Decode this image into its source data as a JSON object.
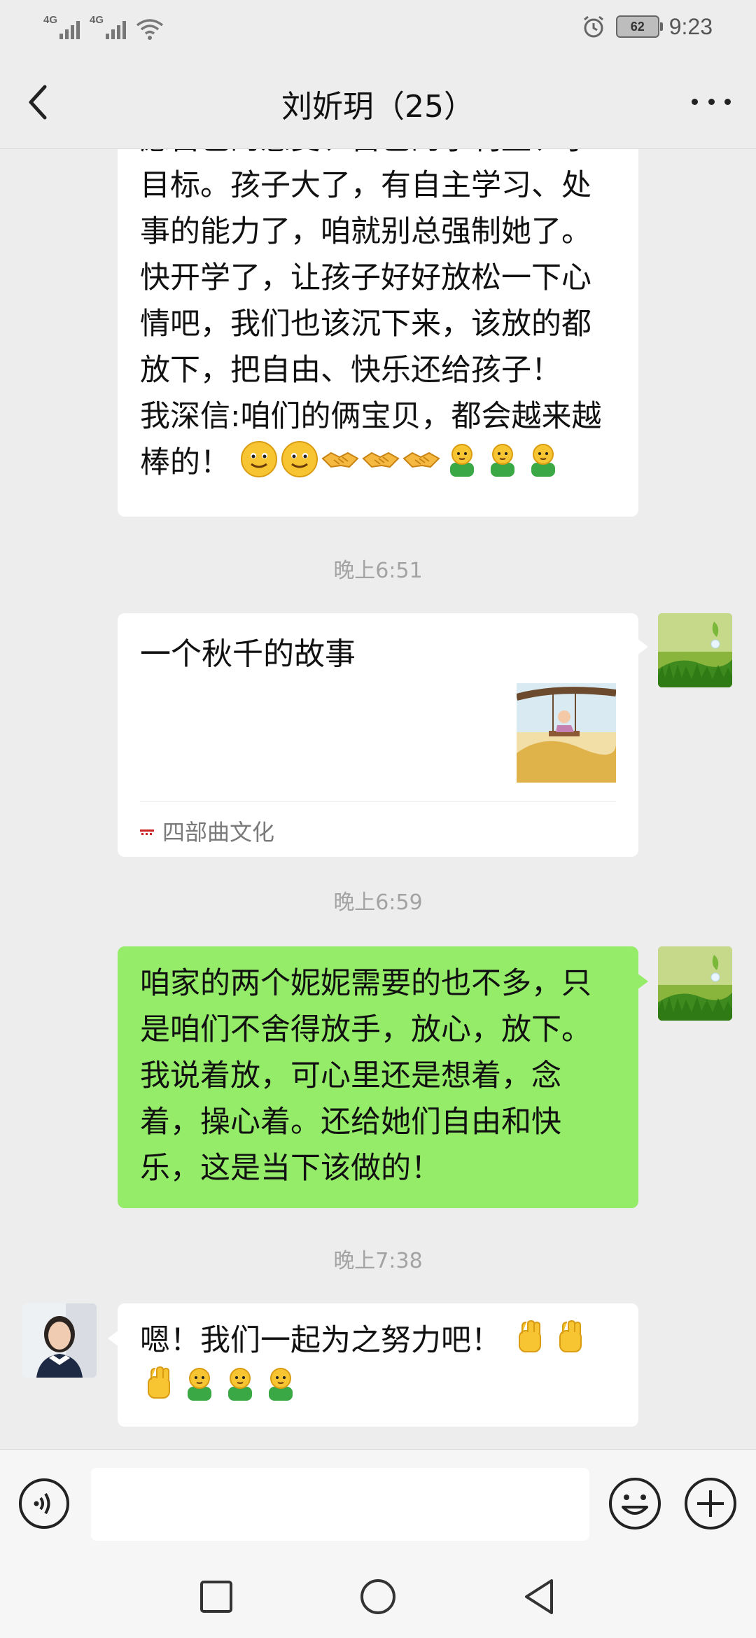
{
  "status_bar": {
    "network_1": "4G",
    "network_2": "4G",
    "battery": "62",
    "time": "9:23"
  },
  "header": {
    "title": "刘妡玥（25）"
  },
  "messages": [
    {
      "type": "text",
      "sender": "other",
      "lines": [
        "愿自己的感受、自己的小利益、小",
        "目标。孩子大了，有自主学习、处",
        "事的能力了，咱就别总强制她了。",
        "快开学了，让孩子好好放松一下心",
        "情吧，我们也该沉下来，该放的都",
        "放下，把自由、快乐还给孩子！",
        "我深信:咱们的俩宝贝，都会越来越",
        "棒的！"
      ],
      "emojis": [
        "smile",
        "smile",
        "handshake",
        "handshake",
        "handshake",
        "person",
        "person",
        "person"
      ]
    },
    {
      "type": "time",
      "text": "晚上6:51"
    },
    {
      "type": "link_card",
      "sender": "self",
      "title": "一个秋千的故事",
      "source": "四部曲文化"
    },
    {
      "type": "time",
      "text": "晚上6:59"
    },
    {
      "type": "text",
      "sender": "self",
      "lines": [
        "咱家的两个妮妮需要的也不多，只",
        "是咱们不舍得放手，放心，放下。",
        "我说着放，可心里还是想着，念",
        "着，操心着。还给她们自由和快",
        "乐，这是当下该做的！"
      ]
    },
    {
      "type": "time",
      "text": "晚上7:38"
    },
    {
      "type": "text",
      "sender": "other",
      "lines": [
        "嗯！我们一起为之努力吧！"
      ],
      "emojis": [
        "fist",
        "fist",
        "fist",
        "person",
        "person",
        "person"
      ]
    }
  ],
  "input": {
    "value": ""
  },
  "colors": {
    "background": "#ededed",
    "self_bubble": "#95ec69",
    "other_bubble": "#ffffff",
    "timestamp": "#a3a3a3"
  },
  "icons": [
    "back-icon",
    "more-icon",
    "voice-icon",
    "emoji-icon",
    "plus-icon",
    "recent-apps-icon",
    "home-icon",
    "back-nav-icon"
  ]
}
